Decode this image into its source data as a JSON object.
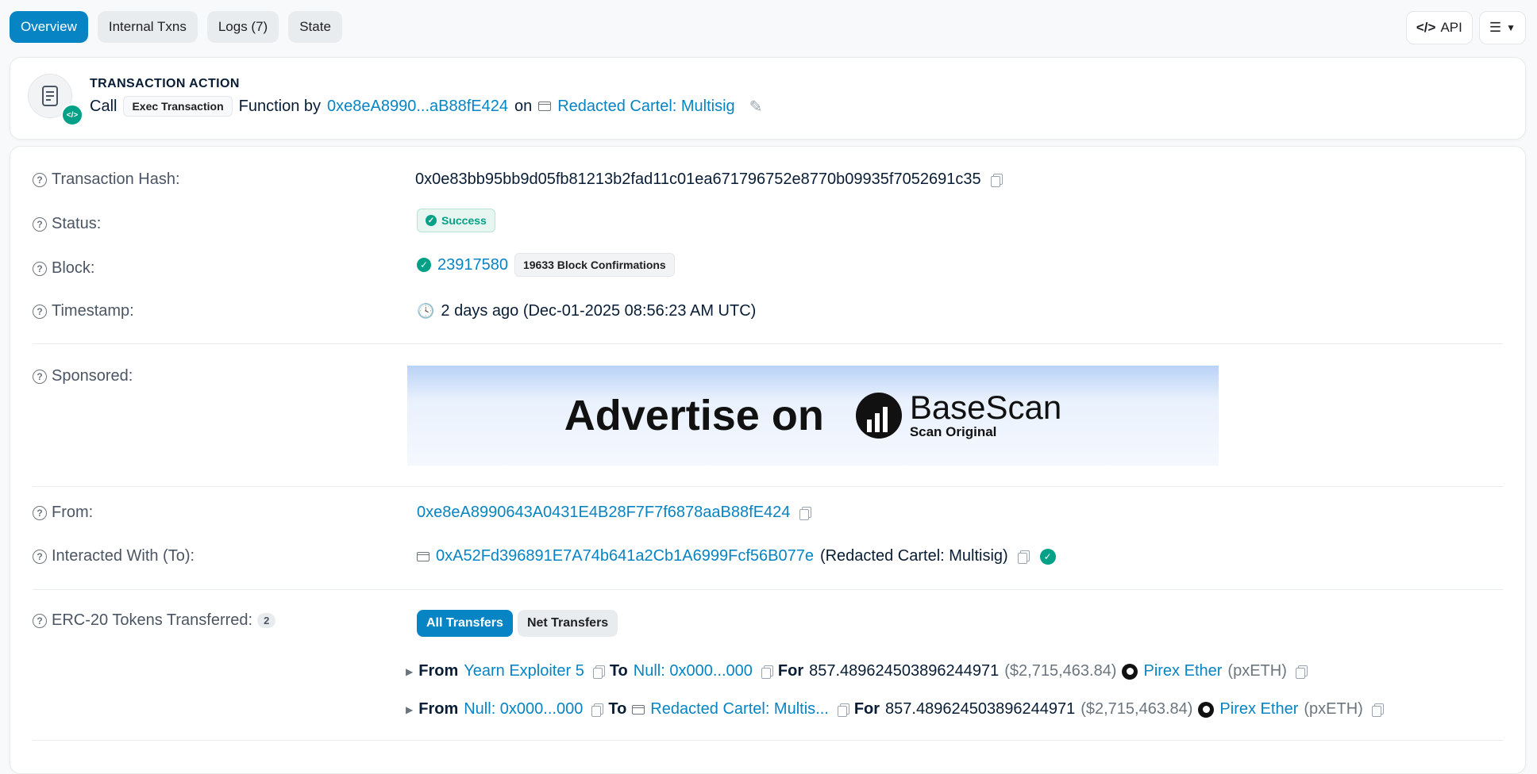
{
  "tabs": [
    {
      "label": "Overview",
      "active": true
    },
    {
      "label": "Internal Txns",
      "active": false
    },
    {
      "label": "Logs (7)",
      "active": false
    },
    {
      "label": "State",
      "active": false
    }
  ],
  "topright": {
    "api_label": "API"
  },
  "action": {
    "title": "TRANSACTION ACTION",
    "call": "Call",
    "function_chip": "Exec Transaction",
    "function_by": "Function by",
    "from_address": "0xe8eA8990...aB88fE424",
    "on": "on",
    "contract_name": "Redacted Cartel: Multisig"
  },
  "fields": {
    "tx_hash": {
      "label": "Transaction Hash:",
      "value": "0x0e83bb95bb9d05fb81213b2fad11c01ea671796752e8770b09935f7052691c35"
    },
    "status": {
      "label": "Status:",
      "value": "Success"
    },
    "block": {
      "label": "Block:",
      "value": "23917580",
      "confirmations": "19633 Block Confirmations"
    },
    "timestamp": {
      "label": "Timestamp:",
      "value": "2 days ago (Dec-01-2025 08:56:23 AM UTC)"
    },
    "sponsored": {
      "label": "Sponsored:",
      "ad_text": "Advertise on",
      "brand": "BaseScan",
      "tagline": "Scan Original"
    },
    "from": {
      "label": "From:",
      "value": "0xe8eA8990643A0431E4B28F7F7f6878aaB88fE424"
    },
    "to": {
      "label": "Interacted With (To):",
      "address": "0xA52Fd396891E7A74b641a2Cb1A6999Fcf56B077e",
      "name": "(Redacted Cartel: Multisig)"
    },
    "erc20": {
      "label": "ERC-20 Tokens Transferred:",
      "count": "2",
      "btn_all": "All Transfers",
      "btn_net": "Net Transfers"
    }
  },
  "transfers": [
    {
      "from_lbl": "From",
      "from": "Yearn Exploiter 5",
      "to_lbl": "To",
      "to": "Null: 0x000...000",
      "for_lbl": "For",
      "amount": "857.489624503896244971",
      "usd": "($2,715,463.84)",
      "token": "Pirex Ether",
      "symbol": "(pxETH)"
    },
    {
      "from_lbl": "From",
      "from": "Null: 0x000...000",
      "to_lbl": "To",
      "to": "Redacted Cartel: Multis...",
      "for_lbl": "For",
      "amount": "857.489624503896244971",
      "usd": "($2,715,463.84)",
      "token": "Pirex Ether",
      "symbol": "(pxETH)"
    }
  ],
  "colors": {
    "primary": "#0784c3",
    "success": "#00a186"
  }
}
